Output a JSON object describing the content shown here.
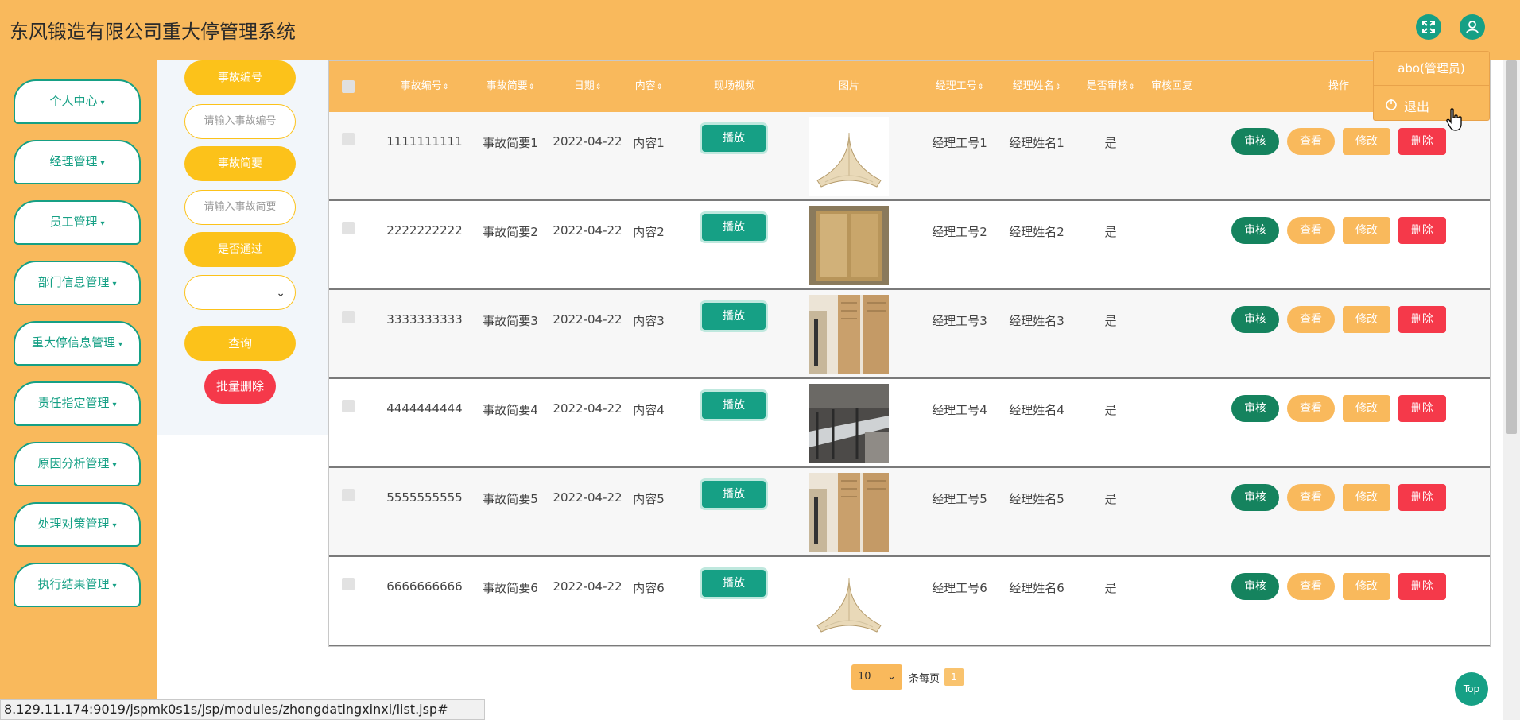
{
  "header": {
    "title": "东风锻造有限公司重大停管理系统",
    "fullscreen_icon": "fullscreen-icon",
    "user_icon": "user-icon"
  },
  "user_menu": {
    "username": "abo(管理员)",
    "logout": "退出"
  },
  "sidebar": {
    "items": [
      {
        "label": "个人中心"
      },
      {
        "label": "经理管理"
      },
      {
        "label": "员工管理"
      },
      {
        "label": "部门信息管理"
      },
      {
        "label": "重大停信息管理"
      },
      {
        "label": "责任指定管理"
      },
      {
        "label": "原因分析管理"
      },
      {
        "label": "处理对策管理"
      },
      {
        "label": "执行结果管理"
      }
    ]
  },
  "search": {
    "field1_label": "事故编号",
    "field1_placeholder": "请输入事故编号",
    "field2_label": "事故简要",
    "field2_placeholder": "请输入事故简要",
    "field3_label": "是否通过",
    "field3_value": "",
    "query_button": "查询",
    "batch_delete_button": "批量删除"
  },
  "table": {
    "columns": [
      "事故编号",
      "事故简要",
      "日期",
      "内容",
      "现场视频",
      "图片",
      "经理工号",
      "经理姓名",
      "是否审核",
      "审核回复",
      "操作"
    ],
    "actions": {
      "review": "审核",
      "view": "查看",
      "edit": "修改",
      "delete": "删除",
      "play": "播放"
    },
    "rows": [
      {
        "no": "1111111111",
        "summary": "事故简要1",
        "date": "2022-04-22",
        "content": "内容1",
        "mgr_no": "经理工号1",
        "mgr_name": "经理姓名1",
        "reviewed": "是",
        "reply": "",
        "image": "open-book"
      },
      {
        "no": "2222222222",
        "summary": "事故简要2",
        "date": "2022-04-22",
        "content": "内容2",
        "mgr_no": "经理工号2",
        "mgr_name": "经理姓名2",
        "reviewed": "是",
        "reply": "",
        "image": "old-book"
      },
      {
        "no": "3333333333",
        "summary": "事故简要3",
        "date": "2022-04-22",
        "content": "内容3",
        "mgr_no": "经理工号3",
        "mgr_name": "经理姓名3",
        "reviewed": "是",
        "reply": "",
        "image": "book-spines"
      },
      {
        "no": "4444444444",
        "summary": "事故简要4",
        "date": "2022-04-22",
        "content": "内容4",
        "mgr_no": "经理工号4",
        "mgr_name": "经理姓名4",
        "reviewed": "是",
        "reply": "",
        "image": "library"
      },
      {
        "no": "5555555555",
        "summary": "事故简要5",
        "date": "2022-04-22",
        "content": "内容5",
        "mgr_no": "经理工号5",
        "mgr_name": "经理姓名5",
        "reviewed": "是",
        "reply": "",
        "image": "book-spines"
      },
      {
        "no": "6666666666",
        "summary": "事故简要6",
        "date": "2022-04-22",
        "content": "内容6",
        "mgr_no": "经理工号6",
        "mgr_name": "经理姓名6",
        "reviewed": "是",
        "reply": "",
        "image": "open-book"
      }
    ]
  },
  "pagination": {
    "page_size": "10",
    "per_page_label": "条每页",
    "current_page": "1"
  },
  "top_button": "Top",
  "status_url": "8.129.11.174:9019/jspmk0s1s/jsp/modules/zhongdatingxinxi/list.jsp#",
  "colors": {
    "primary": "#16a085",
    "header": "#f9b95c",
    "accent": "#fcc21a",
    "danger": "#f5394a"
  }
}
